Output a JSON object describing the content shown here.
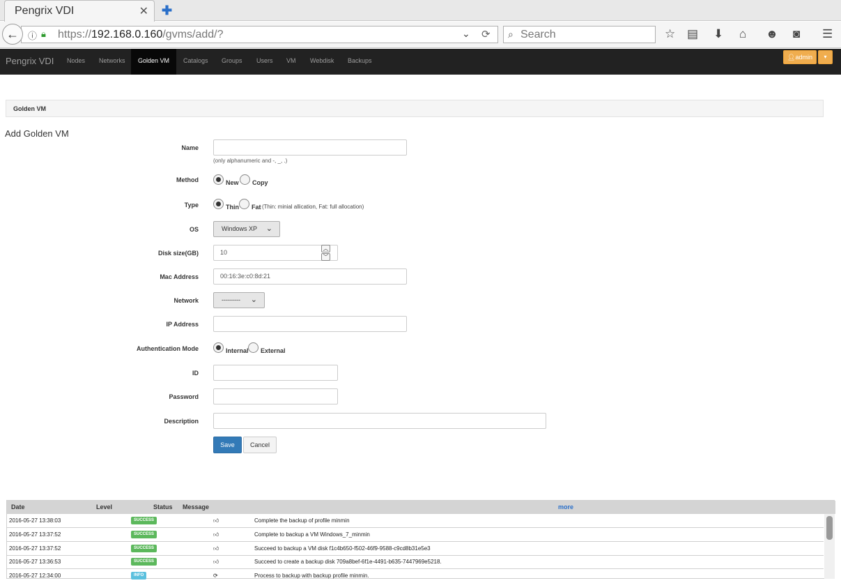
{
  "browser": {
    "tab_title": "Pengrix VDI",
    "tab_close": "✕",
    "new_tab": "✚",
    "url_scheme": "https://",
    "url_host": "192.168.0.160",
    "url_path": "/gvms/add/?",
    "search_placeholder": "Search"
  },
  "navbar": {
    "brand": "Pengrix VDI",
    "items": [
      "Nodes",
      "Networks",
      "Golden VM",
      "Catalogs",
      "Groups",
      "Users",
      "VM",
      "Webdisk",
      "Backups"
    ],
    "active": "Golden VM",
    "user": "admin",
    "caret": "▾",
    "accent_color": "#f0ad4e"
  },
  "breadcrumb": "Golden VM",
  "page_title": "Add Golden VM",
  "form": {
    "name": {
      "label": "Name",
      "value": "",
      "help": "(only alphanumeric and -, _, .)"
    },
    "method": {
      "label": "Method",
      "options": [
        "New",
        "Copy"
      ],
      "selected": "New"
    },
    "type": {
      "label": "Type",
      "options": [
        "Thin",
        "Fat"
      ],
      "selected": "Thin",
      "note": "(Thin: minial allication, Fat: full allocation)"
    },
    "os": {
      "label": "OS",
      "value": "Windows XP"
    },
    "disk": {
      "label": "Disk size(GB)",
      "value": "10"
    },
    "mac": {
      "label": "Mac Address",
      "value": "00:16:3e:c0:8d:21"
    },
    "network": {
      "label": "Network",
      "value": "---------"
    },
    "ip": {
      "label": "IP Address",
      "value": ""
    },
    "auth": {
      "label": "Authentication Mode",
      "options": [
        "Internal",
        "External"
      ],
      "selected": "Internal"
    },
    "id": {
      "label": "ID",
      "value": ""
    },
    "password": {
      "label": "Password",
      "value": ""
    },
    "description": {
      "label": "Description",
      "value": ""
    },
    "save_label": "Save",
    "cancel_label": "Cancel"
  },
  "log": {
    "headers": {
      "date": "Date",
      "level": "Level",
      "status": "Status",
      "message": "Message",
      "more": "more"
    },
    "rows": [
      {
        "date": "2016-05-27 13:38:03",
        "level": "SUCCESS",
        "message": "Complete the backup of profile minmin"
      },
      {
        "date": "2016-05-27 13:37:52",
        "level": "SUCCESS",
        "message": "Complete to backup a VM Windows_7_minmin"
      },
      {
        "date": "2016-05-27 13:37:52",
        "level": "SUCCESS",
        "message": "Succeed to backup a VM disk f1c4b650-f502-46f9-9588-c9cd8b31e5e3"
      },
      {
        "date": "2016-05-27 13:36:53",
        "level": "SUCCESS",
        "message": "Succeed to create a backup disk 709a8bef-6f1e-4491-b635-7447969e5218."
      },
      {
        "date": "2016-05-27 12:34:00",
        "level": "INFO",
        "message": "Process to backup with backup profile minmin."
      }
    ]
  }
}
